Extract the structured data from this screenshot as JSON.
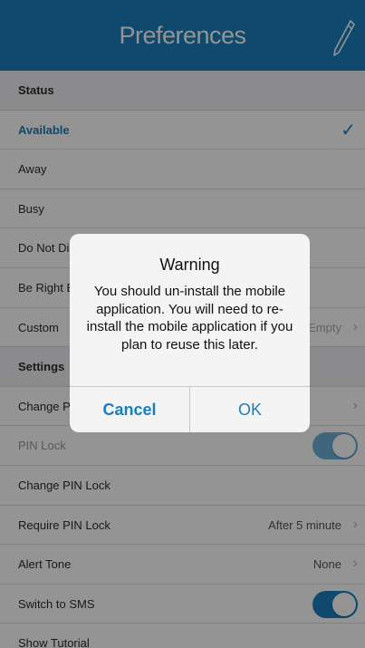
{
  "navbar": {
    "title": "Preferences",
    "edit_icon": "pencil-icon"
  },
  "colors": {
    "accent": "#1a7ebd",
    "section_bg": "#efeff4",
    "overlay": "rgba(0,0,0,0.42)"
  },
  "rows": {
    "status_header": "Status",
    "available": "Available",
    "away": "Away",
    "busy": "Busy",
    "do_not_disturb": "Do Not Disturb",
    "be_right_back": "Be Right Back",
    "custom": "Custom",
    "custom_value": "Empty",
    "settings_header": "Settings",
    "change": "Change PIN",
    "pin_lock": "PIN Lock",
    "pin_lock_on": true,
    "change_pin_lock": "Change PIN Lock",
    "require_pin_lock": "Require PIN Lock",
    "require_pin_lock_value": "After 5 minute",
    "alert_tone": "Alert Tone",
    "alert_tone_value": "None",
    "switch_to_sms": "Switch to SMS",
    "switch_to_sms_on": true,
    "show_tutorial": "Show Tutorial"
  },
  "alert": {
    "title": "Warning",
    "message": "You should un-install the mobile application. You will need to re-install the mobile application if you plan to reuse this later.",
    "cancel_label": "Cancel",
    "ok_label": "OK"
  }
}
